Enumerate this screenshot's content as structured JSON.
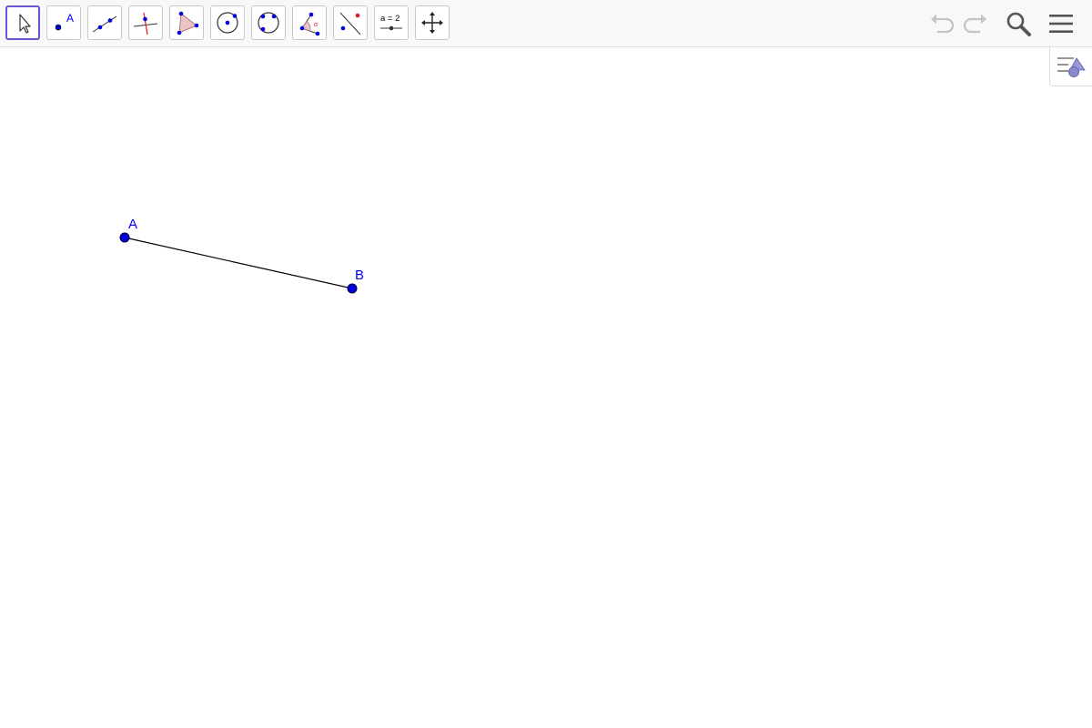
{
  "toolbar": {
    "tools": [
      {
        "id": "move",
        "icon": "move-arrow-icon",
        "selected": true
      },
      {
        "id": "point",
        "icon": "point-icon"
      },
      {
        "id": "line",
        "icon": "line-through-two-points-icon"
      },
      {
        "id": "perpendicular",
        "icon": "perpendicular-line-icon"
      },
      {
        "id": "polygon",
        "icon": "polygon-icon"
      },
      {
        "id": "circle",
        "icon": "circle-center-point-icon"
      },
      {
        "id": "circle3",
        "icon": "circle-through-three-points-icon"
      },
      {
        "id": "angle",
        "icon": "angle-icon"
      },
      {
        "id": "reflect",
        "icon": "reflect-about-line-icon"
      },
      {
        "id": "slider",
        "icon": "slider-icon",
        "label": "a = 2"
      },
      {
        "id": "move-view",
        "icon": "move-graphics-view-icon"
      }
    ],
    "right": [
      {
        "id": "undo",
        "icon": "undo-icon"
      },
      {
        "id": "redo",
        "icon": "redo-icon"
      },
      {
        "id": "search",
        "icon": "search-icon"
      },
      {
        "id": "menu",
        "icon": "hamburger-menu-icon"
      }
    ]
  },
  "view_toggle": {
    "icon": "style-bar-toggle-icon"
  },
  "colors": {
    "point": "#0000ff",
    "point_fill": "#0000e0",
    "label": "#0000ff",
    "segment": "#000000",
    "selected_border": "#6557d2"
  },
  "geometry": {
    "points": [
      {
        "name": "A"
      },
      {
        "name": "B"
      }
    ],
    "segments": [
      {
        "from": "A",
        "to": "B"
      }
    ]
  }
}
